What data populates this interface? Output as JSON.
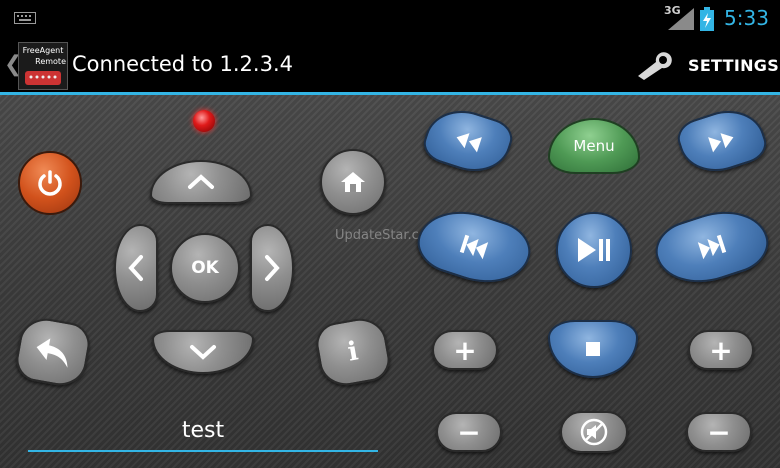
{
  "status_bar": {
    "network": "3G",
    "time": "5:33"
  },
  "action_bar": {
    "app_logo": {
      "line1": "FreeAgent",
      "line2": "Remote"
    },
    "title": "Connected to 1.2.3.4",
    "settings_label": "SETTINGS"
  },
  "remote": {
    "ok_label": "OK",
    "menu_label": "Menu",
    "info_label": "i",
    "vol_up_label": "+",
    "vol_down_label": "−",
    "ch_up_label": "+",
    "ch_down_label": "−",
    "watermark": "UpdateStar.com"
  },
  "input": {
    "value": "test"
  },
  "colors": {
    "accent": "#33b5e5",
    "power": "#d2521c",
    "led": "#e01a1a",
    "media_blue": "#4e7fba",
    "menu_green": "#4f9a55"
  }
}
